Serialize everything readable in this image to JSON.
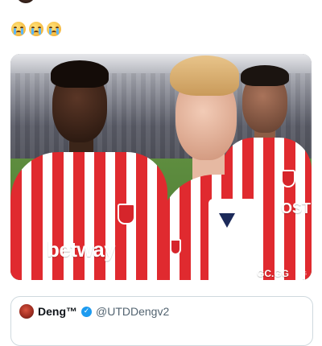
{
  "tweet": {
    "emojis": [
      "crying-face",
      "crying-face",
      "crying-face"
    ],
    "media": {
      "sponsor_left": "betway",
      "sponsor_right": "OST",
      "sponsor_bottom": "GC.GG",
      "watermark": "CBS"
    }
  },
  "quoted": {
    "name": "Deng™",
    "handle": "@UTDDengv2"
  },
  "colors": {
    "kit_red": "#e02a2f",
    "verified_blue": "#1d9bf0",
    "border": "#cfd9de"
  }
}
